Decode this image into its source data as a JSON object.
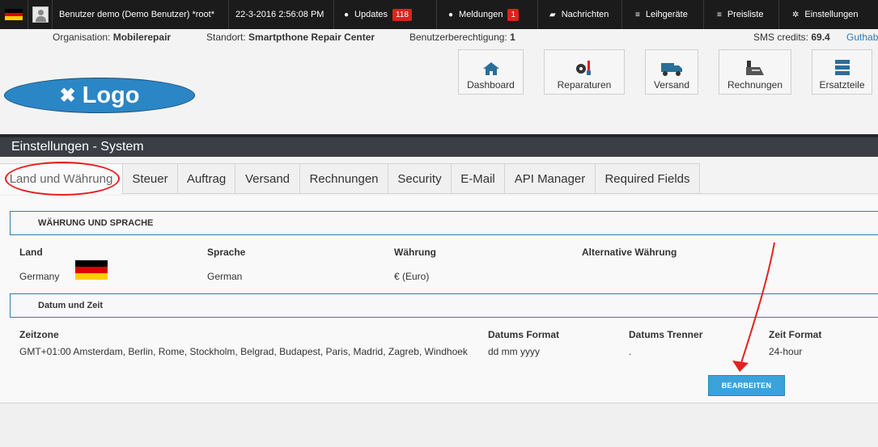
{
  "topbar": {
    "user": "Benutzer demo (Demo Benutzer) *root*",
    "datetime": "22-3-2016 2:56:08 PM",
    "updates_label": "Updates",
    "updates_count": "118",
    "meldungen_label": "Meldungen",
    "meldungen_count": "1",
    "nachrichten_label": "Nachrichten",
    "leihgeraete_label": "Leihgeräte",
    "preisliste_label": "Preisliste",
    "einstellungen_label": "Einstellungen"
  },
  "info": {
    "org_label": "Organisation:",
    "org_value": "Mobilerepair",
    "standort_label": "Standort:",
    "standort_value": "Smartpthone Repair Center",
    "rights_label": "Benutzerberechtigung:",
    "rights_value": "1",
    "sms_label": "SMS credits:",
    "sms_value": "69.4",
    "guthaben_link": "Guthab"
  },
  "logo": {
    "text": "Logo"
  },
  "nav": {
    "dashboard": "Dashboard",
    "reparaturen": "Reparaturen",
    "versand": "Versand",
    "rechnungen": "Rechnungen",
    "ersatzteile": "Ersatzteile"
  },
  "page_title": "Einstellungen - System",
  "tabs": [
    "Land und Währung",
    "Steuer",
    "Auftrag",
    "Versand",
    "Rechnungen",
    "Security",
    "E-Mail",
    "API Manager",
    "Required Fields"
  ],
  "section1": {
    "header": "WÄHRUNG UND SPRACHE",
    "land_label": "Land",
    "land_value": "Germany",
    "sprache_label": "Sprache",
    "sprache_value": "German",
    "waehrung_label": "Währung",
    "waehrung_value": "€ (Euro)",
    "alt_label": "Alternative Währung"
  },
  "section2": {
    "header": "Datum und Zeit",
    "zeitzone_label": "Zeitzone",
    "zeitzone_value": "GMT+01:00 Amsterdam, Berlin, Rome, Stockholm, Belgrad, Budapest, Paris, Madrid, Zagreb, Windhoek",
    "datums_format_label": "Datums Format",
    "datums_format_value": "dd mm yyyy",
    "datums_trenner_label": "Datums Trenner",
    "datums_trenner_value": ".",
    "zeit_format_label": "Zeit Format",
    "zeit_format_value": "24-hour"
  },
  "edit_button": "BEARBEITEN",
  "colors": {
    "accent": "#3aa3db",
    "badge": "#d9241b",
    "annotation": "#e52020",
    "titlebar": "#3b3f45"
  },
  "icons": [
    "flag-de-icon",
    "user-icon",
    "info-icon",
    "chat-icon",
    "list-icon",
    "gear-icon",
    "home-icon",
    "repair-icon",
    "truck-icon",
    "register-icon",
    "server-icon",
    "tools-icon"
  ]
}
